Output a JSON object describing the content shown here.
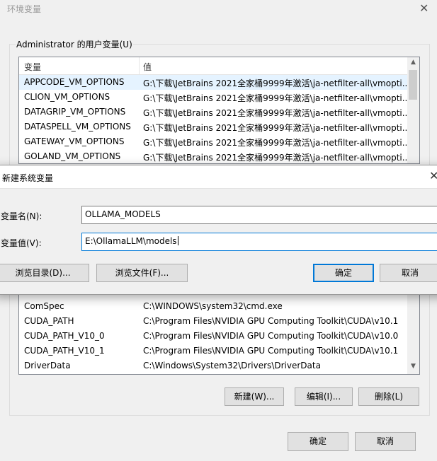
{
  "env_window": {
    "title": "环境变量",
    "close_glyph": "✕",
    "user_group_label": "Administrator 的用户变量(U)",
    "columns": {
      "name": "变量",
      "value": "值"
    },
    "user_vars": [
      {
        "name": "APPCODE_VM_OPTIONS",
        "value": "G:\\下载\\JetBrains 2021全家桶9999年激活\\ja-netfilter-all\\vmopti..."
      },
      {
        "name": "CLION_VM_OPTIONS",
        "value": "G:\\下载\\JetBrains 2021全家桶9999年激活\\ja-netfilter-all\\vmopti..."
      },
      {
        "name": "DATAGRIP_VM_OPTIONS",
        "value": "G:\\下载\\JetBrains 2021全家桶9999年激活\\ja-netfilter-all\\vmopti..."
      },
      {
        "name": "DATASPELL_VM_OPTIONS",
        "value": "G:\\下载\\JetBrains 2021全家桶9999年激活\\ja-netfilter-all\\vmopti..."
      },
      {
        "name": "GATEWAY_VM_OPTIONS",
        "value": "G:\\下载\\JetBrains 2021全家桶9999年激活\\ja-netfilter-all\\vmopti..."
      },
      {
        "name": "GOLAND_VM_OPTIONS",
        "value": "G:\\下载\\JetBrains 2021全家桶9999年激活\\ja-netfilter-all\\vmopti..."
      }
    ],
    "system_vars": [
      {
        "name": "ComSpec",
        "value": "C:\\WINDOWS\\system32\\cmd.exe"
      },
      {
        "name": "CUDA_PATH",
        "value": "C:\\Program Files\\NVIDIA GPU Computing Toolkit\\CUDA\\v10.1"
      },
      {
        "name": "CUDA_PATH_V10_0",
        "value": "C:\\Program Files\\NVIDIA GPU Computing Toolkit\\CUDA\\v10.0"
      },
      {
        "name": "CUDA_PATH_V10_1",
        "value": "C:\\Program Files\\NVIDIA GPU Computing Toolkit\\CUDA\\v10.1"
      },
      {
        "name": "DriverData",
        "value": "C:\\Windows\\System32\\Drivers\\DriverData"
      }
    ],
    "system_buttons": {
      "new": "新建(W)...",
      "edit": "编辑(I)...",
      "delete": "删除(L)"
    },
    "footer_buttons": {
      "ok": "确定",
      "cancel": "取消"
    },
    "scroll_up_glyph": "▲",
    "scroll_down_glyph": "▼"
  },
  "new_var_dialog": {
    "title": "新建系统变量",
    "close_glyph": "✕",
    "name_label": "变量名(N):",
    "name_value": "OLLAMA_MODELS",
    "value_label": "变量值(V):",
    "value_value": "E:\\OllamaLLM\\models",
    "browse_dir": "浏览目录(D)...",
    "browse_file": "浏览文件(F)...",
    "ok": "确定",
    "cancel": "取消"
  },
  "colors": {
    "accent": "#0078d7",
    "selected_row": "#e5f3ff"
  }
}
